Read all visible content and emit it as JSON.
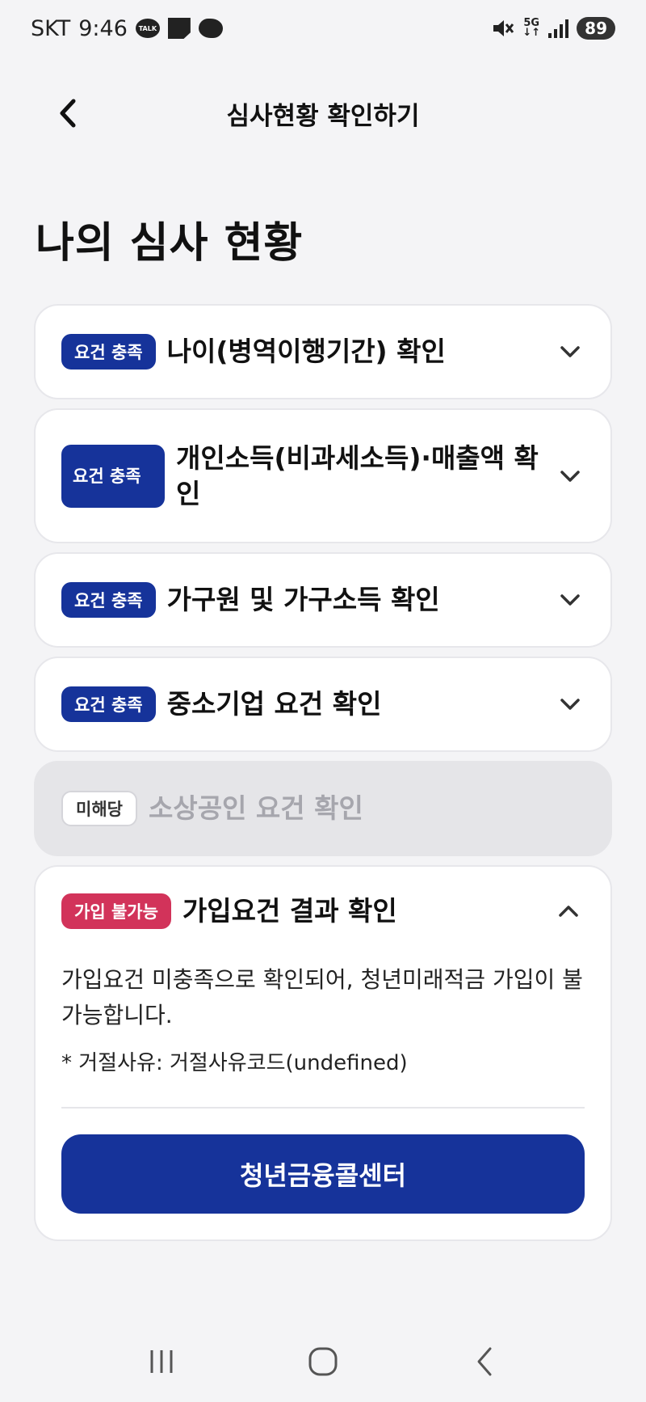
{
  "status_bar": {
    "carrier": "SKT",
    "time": "9:46",
    "talk_icon_text": "TALK",
    "network": "5G",
    "battery": "89"
  },
  "header": {
    "title": "심사현황 확인하기"
  },
  "main": {
    "heading": "나의 심사 현황",
    "items": [
      {
        "badge": "요건 충족",
        "title": "나이(병역이행기간) 확인",
        "state": "met"
      },
      {
        "badge": "요건 충족",
        "title": "개인소득(비과세소득)·매출액 확인",
        "state": "met"
      },
      {
        "badge": "요건 충족",
        "title": "가구원 및 가구소득 확인",
        "state": "met"
      },
      {
        "badge": "요건 충족",
        "title": "중소기업 요건 확인",
        "state": "met"
      },
      {
        "badge": "미해당",
        "title": "소상공인 요건 확인",
        "state": "not-applicable"
      }
    ],
    "result": {
      "badge": "가입 불가능",
      "title": "가입요건 결과 확인",
      "message": "가입요건 미충족으로 확인되어, 청년미래적금 가입이 불가능합니다.",
      "reason": "* 거절사유: 거절사유코드(undefined)",
      "cta_label": "청년금융콜센터"
    }
  },
  "colors": {
    "primary": "#16339a",
    "danger": "#d2335a",
    "background": "#f4f4f6"
  }
}
